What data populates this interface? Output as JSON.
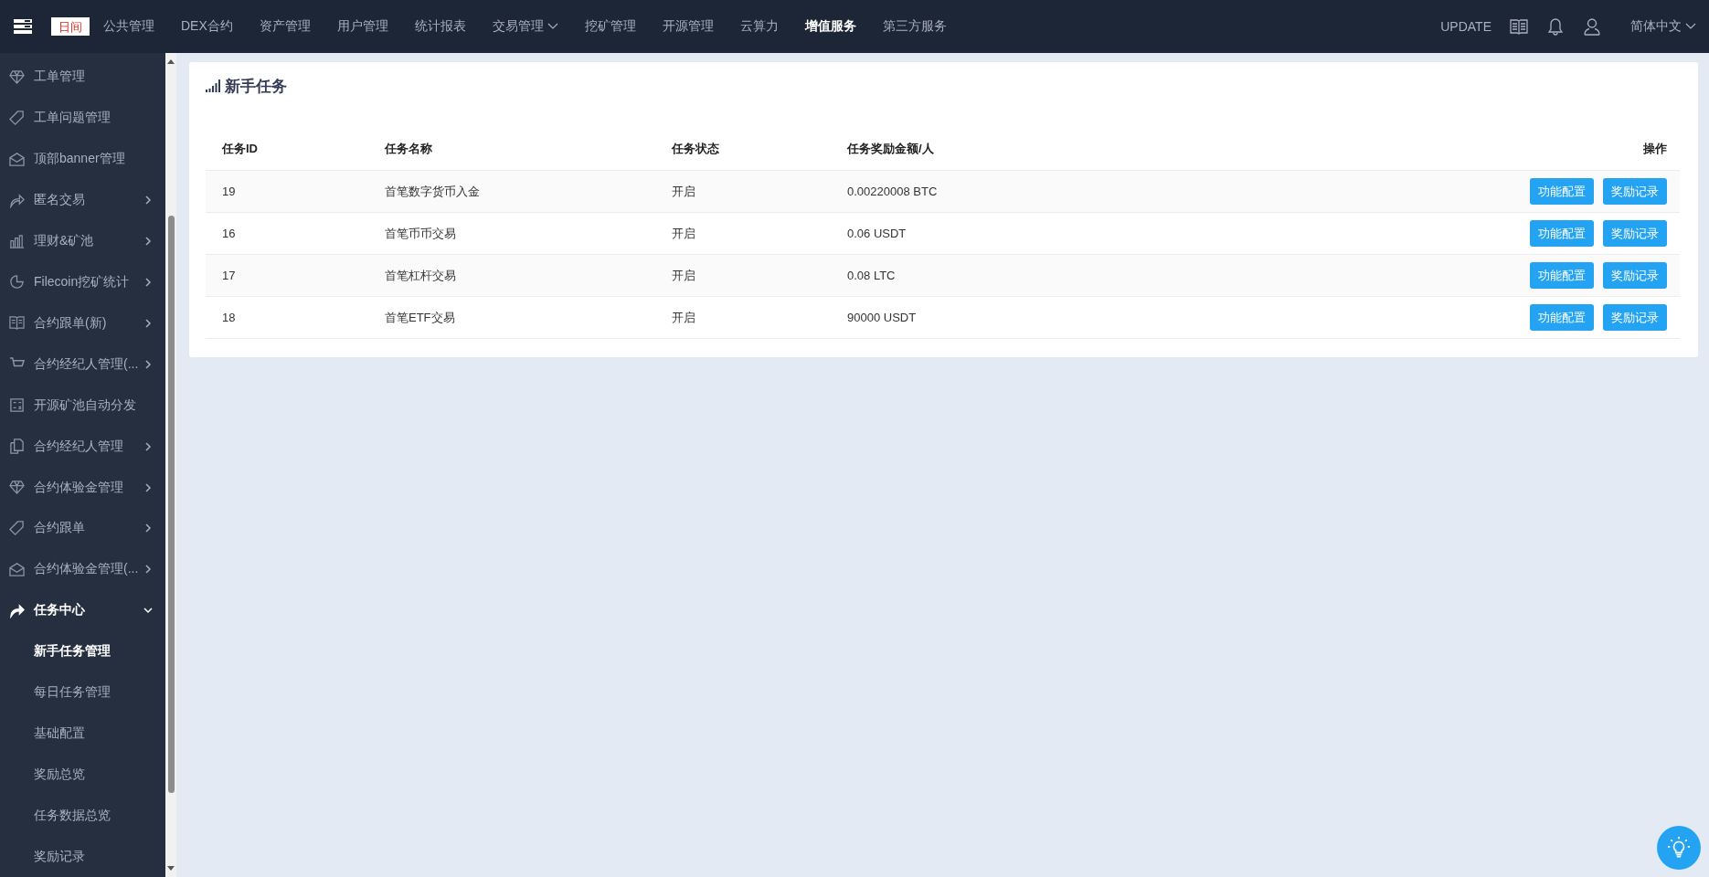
{
  "topbar": {
    "theme_toggle": "日间",
    "nav": [
      {
        "label": "公共管理",
        "selected": false,
        "kind": "link"
      },
      {
        "label": "DEX合约",
        "selected": false,
        "kind": "link"
      },
      {
        "label": "资产管理",
        "selected": false,
        "kind": "link"
      },
      {
        "label": "用户管理",
        "selected": false,
        "kind": "link"
      },
      {
        "label": "统计报表",
        "selected": false,
        "kind": "link"
      },
      {
        "label": "交易管理",
        "selected": false,
        "kind": "dropdown"
      },
      {
        "label": "挖矿管理",
        "selected": false,
        "kind": "link"
      },
      {
        "label": "开源管理",
        "selected": false,
        "kind": "link"
      },
      {
        "label": "云算力",
        "selected": false,
        "kind": "link"
      },
      {
        "label": "增值服务",
        "selected": true,
        "kind": "link"
      },
      {
        "label": "第三方服务",
        "selected": false,
        "kind": "link"
      }
    ],
    "update": "UPDATE",
    "language": "简体中文"
  },
  "sidebar": {
    "items": [
      {
        "label": "工单管理",
        "kind": "link"
      },
      {
        "label": "工单问题管理",
        "kind": "link"
      },
      {
        "label": "顶部banner管理",
        "kind": "link"
      },
      {
        "label": "匿名交易",
        "kind": "submenu",
        "expanded": false
      },
      {
        "label": "理财&矿池",
        "kind": "submenu",
        "expanded": false
      },
      {
        "label": "Filecoin挖矿统计",
        "kind": "submenu",
        "expanded": false
      },
      {
        "label": "合约跟单(新)",
        "kind": "submenu",
        "expanded": false
      },
      {
        "label": "合约经纪人管理(...",
        "kind": "submenu",
        "expanded": false
      },
      {
        "label": "开源矿池自动分发",
        "kind": "link"
      },
      {
        "label": "合约经纪人管理",
        "kind": "submenu",
        "expanded": false
      },
      {
        "label": "合约体验金管理",
        "kind": "submenu",
        "expanded": false
      },
      {
        "label": "合约跟单",
        "kind": "submenu",
        "expanded": false
      },
      {
        "label": "合约体验金管理(...",
        "kind": "submenu",
        "expanded": false
      },
      {
        "label": "任务中心",
        "kind": "submenu",
        "expanded": true,
        "children": [
          {
            "label": "新手任务管理",
            "selected": true
          },
          {
            "label": "每日任务管理",
            "selected": false
          },
          {
            "label": "基础配置",
            "selected": false
          },
          {
            "label": "奖励总览",
            "selected": false
          },
          {
            "label": "任务数据总览",
            "selected": false
          },
          {
            "label": "奖励记录",
            "selected": false
          }
        ]
      }
    ]
  },
  "card": {
    "title": "新手任务",
    "table": {
      "columns": [
        "任务ID",
        "任务名称",
        "任务状态",
        "任务奖励金额/人",
        "操作"
      ],
      "rows": [
        {
          "id": "19",
          "name": "首笔数字货币入金",
          "status": "开启",
          "reward": "0.00220008 BTC",
          "actions": [
            "功能配置",
            "奖励记录"
          ]
        },
        {
          "id": "16",
          "name": "首笔币币交易",
          "status": "开启",
          "reward": "0.06 USDT",
          "actions": [
            "功能配置",
            "奖励记录"
          ]
        },
        {
          "id": "17",
          "name": "首笔杠杆交易",
          "status": "开启",
          "reward": "0.08 LTC",
          "actions": [
            "功能配置",
            "奖励记录"
          ]
        },
        {
          "id": "18",
          "name": "首笔ETF交易",
          "status": "开启",
          "reward": "90000 USDT",
          "actions": [
            "功能配置",
            "奖励记录"
          ]
        }
      ]
    }
  }
}
